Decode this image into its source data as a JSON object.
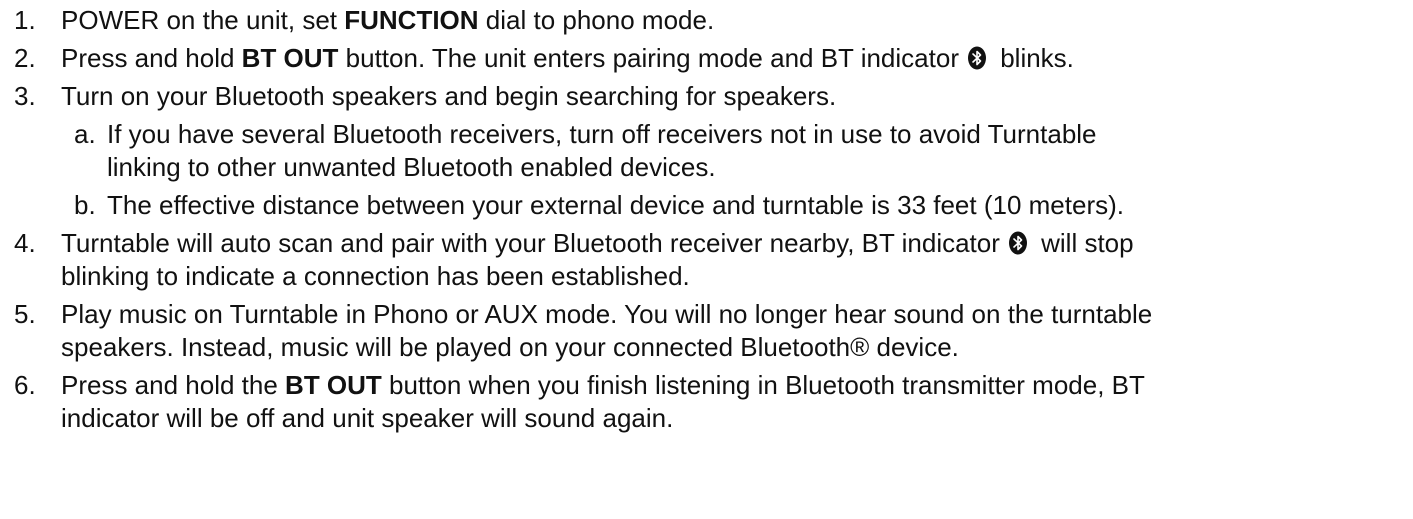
{
  "steps": [
    {
      "num": "1.",
      "lines": [
        {
          "a": "POWER on the unit, set ",
          "b": "FUNCTION",
          "c": " dial to phono mode."
        }
      ]
    },
    {
      "num": "2.",
      "lines": [
        {
          "a": "Press and hold ",
          "b": "BT OUT",
          "c": " button. The unit enters pairing mode and BT indicator",
          "d": " blinks."
        }
      ]
    },
    {
      "num": "3.",
      "lines": [
        {
          "a": "Turn on your Bluetooth speakers and begin searching for speakers."
        }
      ],
      "sub": [
        {
          "num": "a.",
          "lines": [
            "If you have several Bluetooth receivers, turn off receivers not in use to avoid Turntable",
            "linking to other unwanted Bluetooth enabled devices."
          ]
        },
        {
          "num": "b.",
          "lines": [
            "The effective distance between your external device and turntable is 33 feet (10 meters)."
          ]
        }
      ]
    },
    {
      "num": "4.",
      "lines": [
        {
          "a": "Turntable will auto scan and pair with your Bluetooth receiver nearby, BT indicator",
          "d": " will stop"
        },
        {
          "a": "blinking to indicate a connection has been established."
        }
      ]
    },
    {
      "num": "5.",
      "lines": [
        {
          "a": "Play music on Turntable in Phono or AUX mode. You will no longer hear sound on the turntable"
        },
        {
          "a": "speakers. Instead, music will be played on your connected Bluetooth® device."
        }
      ]
    },
    {
      "num": "6.",
      "lines": [
        {
          "a": "Press and hold the ",
          "b": "BT OUT",
          "c": " button when you finish listening in Bluetooth transmitter mode, BT"
        },
        {
          "a": "indicator will be off and unit speaker will sound again."
        }
      ]
    }
  ],
  "icons": {
    "bt_indicator": "bluetooth-indicator-icon"
  }
}
